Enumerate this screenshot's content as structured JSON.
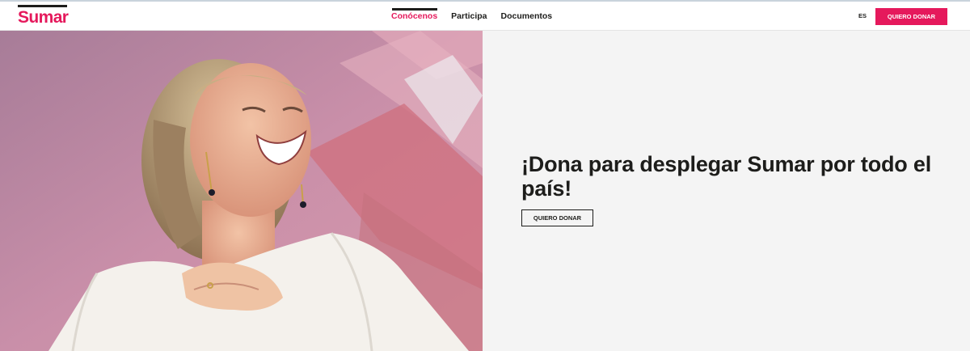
{
  "brand": {
    "name": "Sumar",
    "color": "#e5195c"
  },
  "nav": {
    "items": [
      {
        "label": "Conócenos",
        "active": true
      },
      {
        "label": "Participa",
        "active": false
      },
      {
        "label": "Documentos",
        "active": false
      }
    ]
  },
  "header": {
    "language": "ES",
    "donate_label": "QUIERO DONAR"
  },
  "hero": {
    "title": "¡Dona para desplegar Sumar por todo el país!",
    "button_label": "QUIERO DONAR",
    "image_subject": "smiling-woman-portrait"
  }
}
